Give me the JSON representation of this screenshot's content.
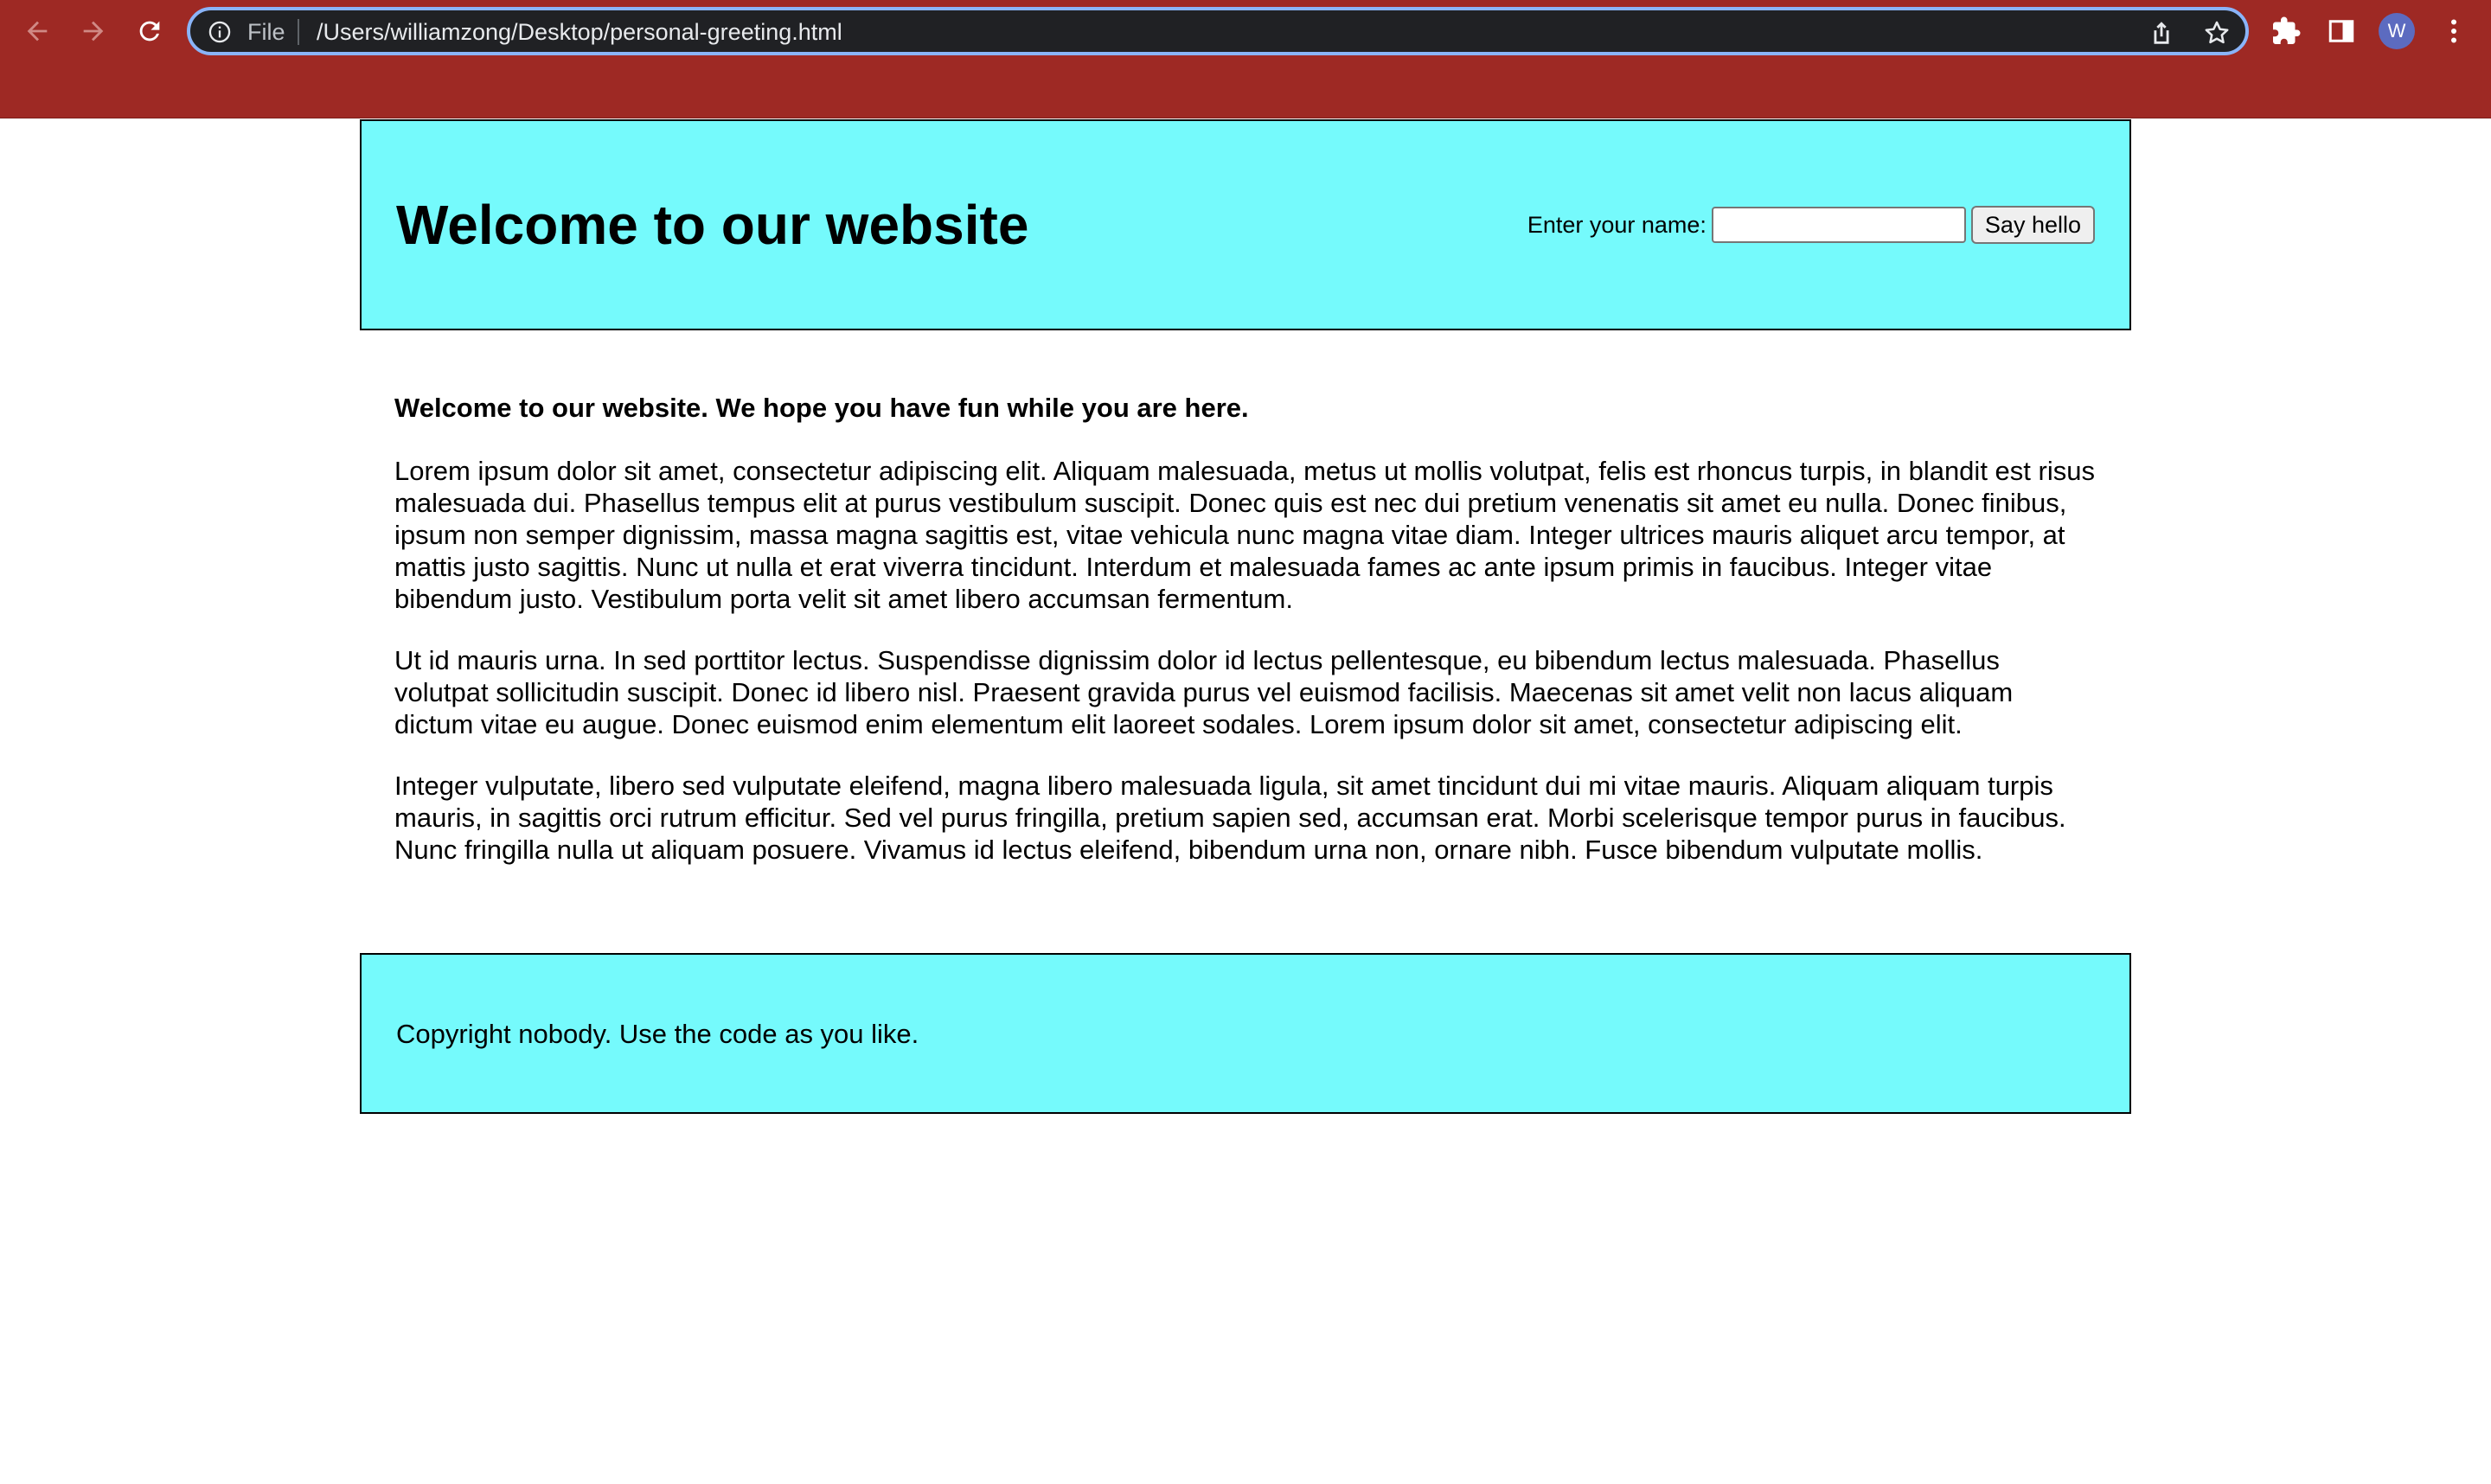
{
  "browser": {
    "scheme_label": "File",
    "url": "/Users/williamzong/Desktop/personal-greeting.html",
    "profile_initial": "W",
    "accent_color": "#9e2924",
    "icons": [
      "back-arrow-icon",
      "forward-arrow-icon",
      "reload-icon",
      "info-icon",
      "share-icon",
      "star-icon",
      "extensions-icon",
      "side-panel-icon",
      "more-menu-icon"
    ]
  },
  "header": {
    "title": "Welcome to our website",
    "name_label": "Enter your name:",
    "name_value": "",
    "say_hello_label": "Say hello",
    "background_color": "#75fafc"
  },
  "main": {
    "lead": "Welcome to our website. We hope you have fun while you are here.",
    "paragraphs": [
      "Lorem ipsum dolor sit amet, consectetur adipiscing elit. Aliquam malesuada, metus ut mollis volutpat, felis est rhoncus turpis, in blandit est risus malesuada dui. Phasellus tempus elit at purus vestibulum suscipit. Donec quis est nec dui pretium venenatis sit amet eu nulla. Donec finibus, ipsum non semper dignissim, massa magna sagittis est, vitae vehicula nunc magna vitae diam. Integer ultrices mauris aliquet arcu tempor, at mattis justo sagittis. Nunc ut nulla et erat viverra tincidunt. Interdum et malesuada fames ac ante ipsum primis in faucibus. Integer vitae bibendum justo. Vestibulum porta velit sit amet libero accumsan fermentum.",
      "Ut id mauris urna. In sed porttitor lectus. Suspendisse dignissim dolor id lectus pellentesque, eu bibendum lectus malesuada. Phasellus volutpat sollicitudin suscipit. Donec id libero nisl. Praesent gravida purus vel euismod facilisis. Maecenas sit amet velit non lacus aliquam dictum vitae eu augue. Donec euismod enim elementum elit laoreet sodales. Lorem ipsum dolor sit amet, consectetur adipiscing elit.",
      "Integer vulputate, libero sed vulputate eleifend, magna libero malesuada ligula, sit amet tincidunt dui mi vitae mauris. Aliquam aliquam turpis mauris, in sagittis orci rutrum efficitur. Sed vel purus fringilla, pretium sapien sed, accumsan erat. Morbi scelerisque tempor purus in faucibus. Nunc fringilla nulla ut aliquam posuere. Vivamus id lectus eleifend, bibendum urna non, ornare nibh. Fusce bibendum vulputate mollis."
    ]
  },
  "footer": {
    "text": "Copyright nobody. Use the code as you like."
  }
}
